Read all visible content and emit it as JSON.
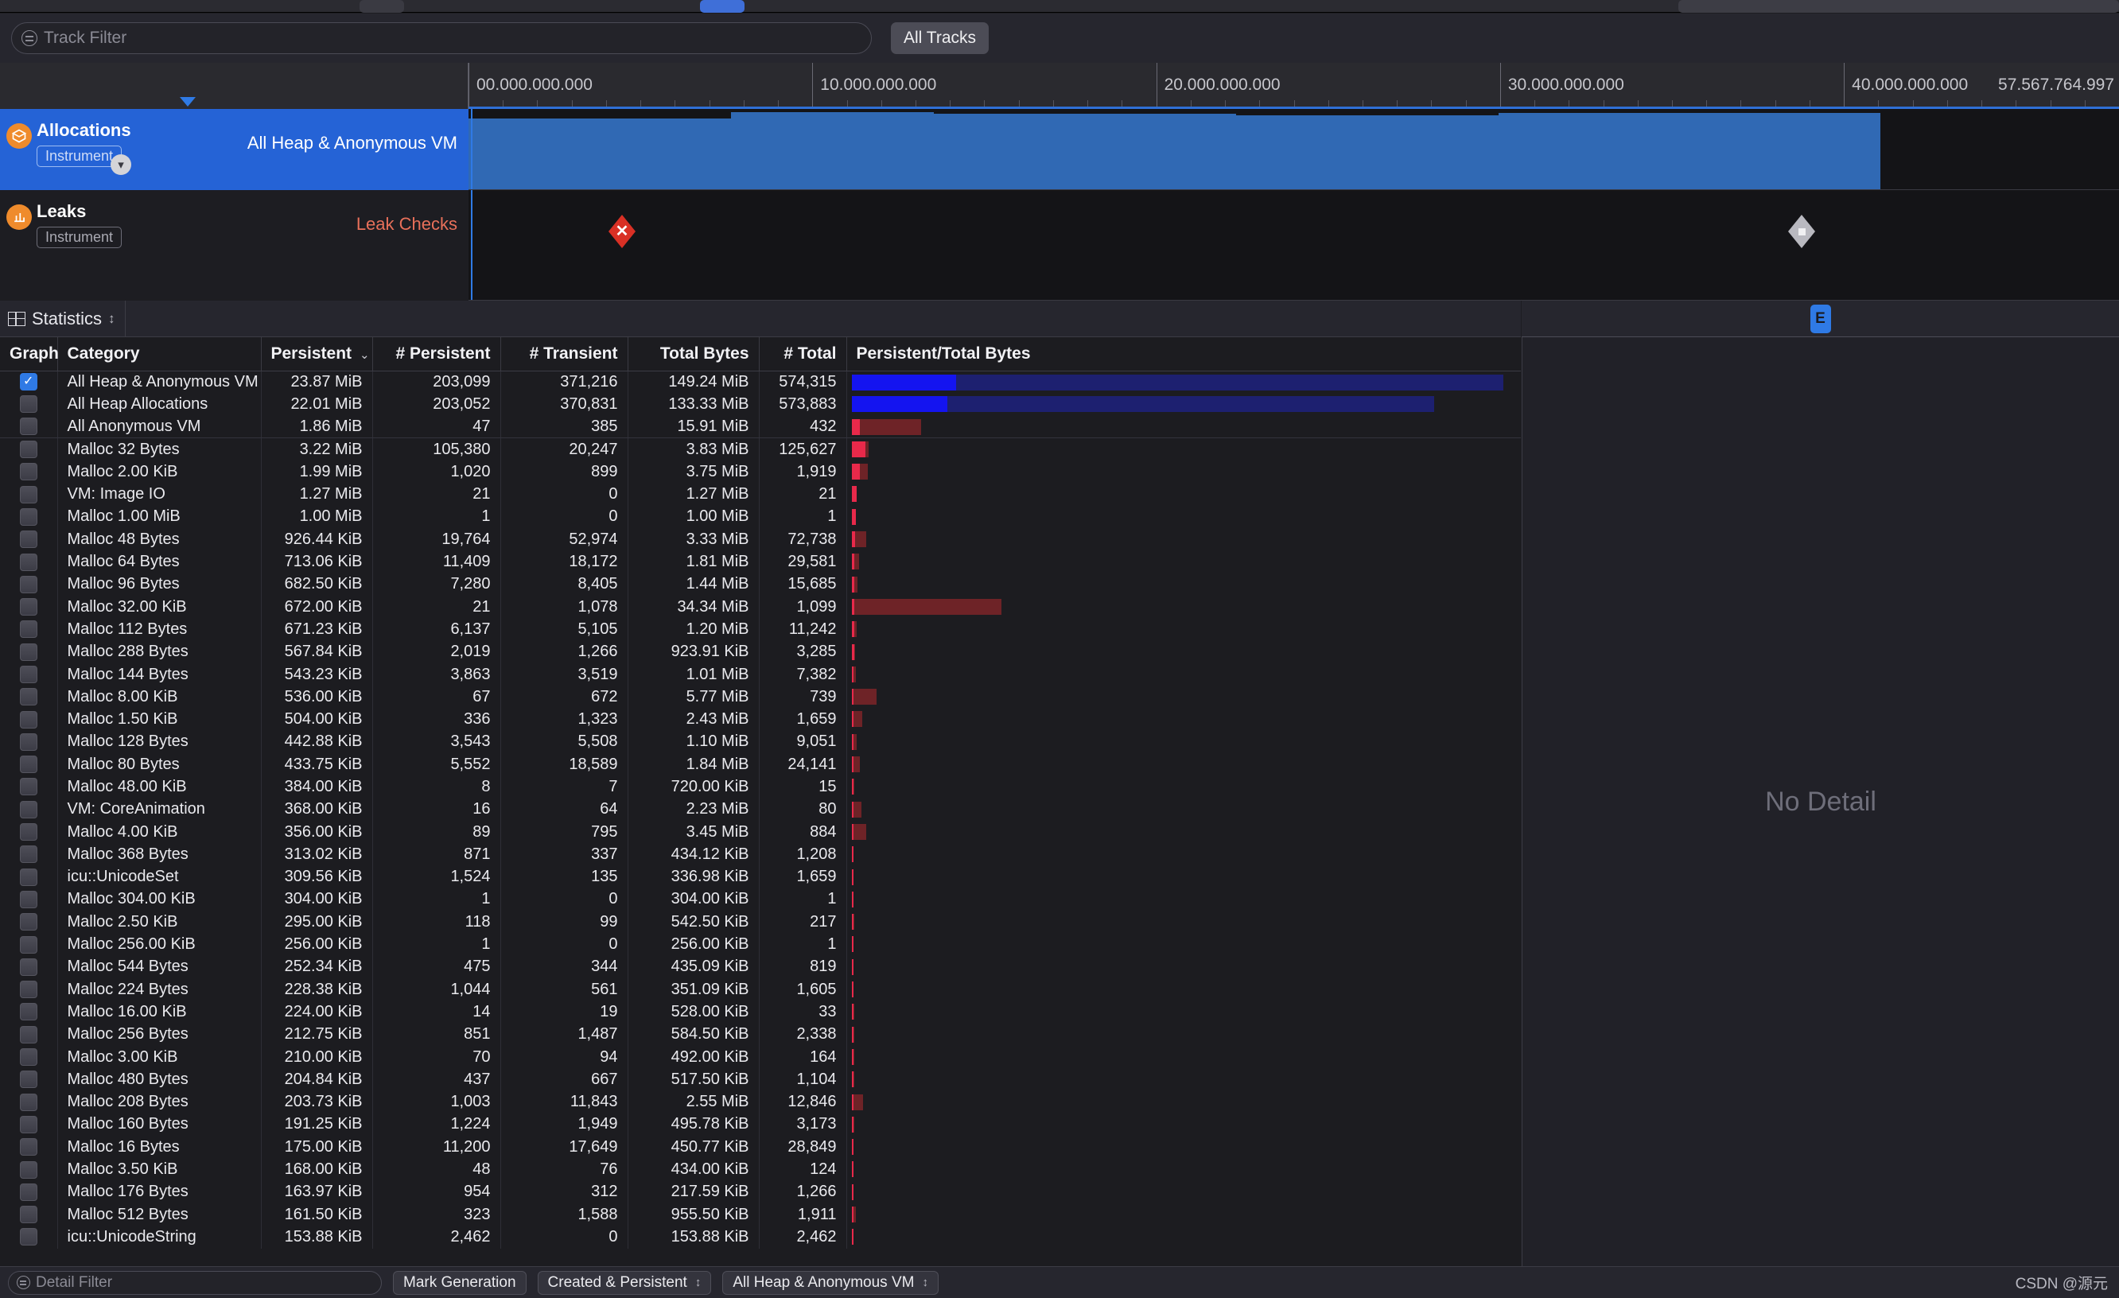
{
  "toolbar": {
    "track_filter_placeholder": "Track Filter",
    "all_tracks_label": "All Tracks"
  },
  "ruler": {
    "ticks": [
      "00.000.000.000",
      "10.000.000.000",
      "20.000.000.000",
      "30.000.000.000",
      "40.000.000.000"
    ],
    "end_label": "57.567.764.997"
  },
  "tracks": [
    {
      "name": "Allocations",
      "badge": "Instrument",
      "subtitle": "All Heap & Anonymous VM",
      "selected": true
    },
    {
      "name": "Leaks",
      "badge": "Instrument",
      "subtitle": "Leak Checks",
      "selected": false
    }
  ],
  "stats": {
    "label": "Statistics",
    "detail_badge": "E",
    "no_detail": "No Detail"
  },
  "table": {
    "columns": [
      "Graph",
      "Category",
      "Persistent",
      "# Persistent",
      "# Transient",
      "Total Bytes",
      "# Total",
      "Persistent/Total Bytes"
    ],
    "sorted_column": "Persistent",
    "rows": [
      {
        "checked": true,
        "category": "All Heap & Anonymous VM",
        "persistent": "23.87 MiB",
        "n_persistent": "203,099",
        "n_transient": "371,216",
        "total_bytes": "149.24 MiB",
        "n_total": "574,315",
        "bar_persist_pct": 16.0,
        "bar_total_pct": 100.0,
        "bar_color": "blue",
        "group_end": false
      },
      {
        "checked": false,
        "category": "All Heap Allocations",
        "persistent": "22.01 MiB",
        "n_persistent": "203,052",
        "n_transient": "370,831",
        "total_bytes": "133.33 MiB",
        "n_total": "573,883",
        "bar_persist_pct": 14.7,
        "bar_total_pct": 89.3,
        "bar_color": "blue",
        "group_end": false
      },
      {
        "checked": false,
        "category": "All Anonymous VM",
        "persistent": "1.86 MiB",
        "n_persistent": "47",
        "n_transient": "385",
        "total_bytes": "15.91 MiB",
        "n_total": "432",
        "bar_persist_pct": 1.25,
        "bar_total_pct": 10.7,
        "bar_color": "red",
        "group_end": true
      },
      {
        "checked": false,
        "category": "Malloc 32 Bytes",
        "persistent": "3.22 MiB",
        "n_persistent": "105,380",
        "n_transient": "20,247",
        "total_bytes": "3.83 MiB",
        "n_total": "125,627",
        "bar_persist_pct": 2.16,
        "bar_total_pct": 2.6,
        "bar_color": "red",
        "group_end": false
      },
      {
        "checked": false,
        "category": "Malloc 2.00 KiB",
        "persistent": "1.99 MiB",
        "n_persistent": "1,020",
        "n_transient": "899",
        "total_bytes": "3.75 MiB",
        "n_total": "1,919",
        "bar_persist_pct": 1.33,
        "bar_total_pct": 2.5,
        "bar_color": "red",
        "group_end": false
      },
      {
        "checked": false,
        "category": "VM: Image IO",
        "persistent": "1.27 MiB",
        "n_persistent": "21",
        "n_transient": "0",
        "total_bytes": "1.27 MiB",
        "n_total": "21",
        "bar_persist_pct": 0.85,
        "bar_total_pct": 0.85,
        "bar_color": "red",
        "group_end": false
      },
      {
        "checked": false,
        "category": "Malloc 1.00 MiB",
        "persistent": "1.00 MiB",
        "n_persistent": "1",
        "n_transient": "0",
        "total_bytes": "1.00 MiB",
        "n_total": "1",
        "bar_persist_pct": 0.67,
        "bar_total_pct": 0.67,
        "bar_color": "red",
        "group_end": false
      },
      {
        "checked": false,
        "category": "Malloc 48 Bytes",
        "persistent": "926.44 KiB",
        "n_persistent": "19,764",
        "n_transient": "52,974",
        "total_bytes": "3.33 MiB",
        "n_total": "72,738",
        "bar_persist_pct": 0.6,
        "bar_total_pct": 2.23,
        "bar_color": "red",
        "group_end": false
      },
      {
        "checked": false,
        "category": "Malloc 64 Bytes",
        "persistent": "713.06 KiB",
        "n_persistent": "11,409",
        "n_transient": "18,172",
        "total_bytes": "1.81 MiB",
        "n_total": "29,581",
        "bar_persist_pct": 0.47,
        "bar_total_pct": 1.21,
        "bar_color": "red",
        "group_end": false
      },
      {
        "checked": false,
        "category": "Malloc 96 Bytes",
        "persistent": "682.50 KiB",
        "n_persistent": "7,280",
        "n_transient": "8,405",
        "total_bytes": "1.44 MiB",
        "n_total": "15,685",
        "bar_persist_pct": 0.45,
        "bar_total_pct": 0.96,
        "bar_color": "red",
        "group_end": false
      },
      {
        "checked": false,
        "category": "Malloc 32.00 KiB",
        "persistent": "672.00 KiB",
        "n_persistent": "21",
        "n_transient": "1,078",
        "total_bytes": "34.34 MiB",
        "n_total": "1,099",
        "bar_persist_pct": 0.44,
        "bar_total_pct": 23.0,
        "bar_color": "red",
        "group_end": false
      },
      {
        "checked": false,
        "category": "Malloc 112 Bytes",
        "persistent": "671.23 KiB",
        "n_persistent": "6,137",
        "n_transient": "5,105",
        "total_bytes": "1.20 MiB",
        "n_total": "11,242",
        "bar_persist_pct": 0.44,
        "bar_total_pct": 0.8,
        "bar_color": "red",
        "group_end": false
      },
      {
        "checked": false,
        "category": "Malloc 288 Bytes",
        "persistent": "567.84 KiB",
        "n_persistent": "2,019",
        "n_transient": "1,266",
        "total_bytes": "923.91 KiB",
        "n_total": "3,285",
        "bar_persist_pct": 0.37,
        "bar_total_pct": 0.6,
        "bar_color": "red",
        "group_end": false
      },
      {
        "checked": false,
        "category": "Malloc 144 Bytes",
        "persistent": "543.23 KiB",
        "n_persistent": "3,863",
        "n_transient": "3,519",
        "total_bytes": "1.01 MiB",
        "n_total": "7,382",
        "bar_persist_pct": 0.36,
        "bar_total_pct": 0.68,
        "bar_color": "red",
        "group_end": false
      },
      {
        "checked": false,
        "category": "Malloc 8.00 KiB",
        "persistent": "536.00 KiB",
        "n_persistent": "67",
        "n_transient": "672",
        "total_bytes": "5.77 MiB",
        "n_total": "739",
        "bar_persist_pct": 0.35,
        "bar_total_pct": 3.87,
        "bar_color": "red",
        "group_end": false
      },
      {
        "checked": false,
        "category": "Malloc 1.50 KiB",
        "persistent": "504.00 KiB",
        "n_persistent": "336",
        "n_transient": "1,323",
        "total_bytes": "2.43 MiB",
        "n_total": "1,659",
        "bar_persist_pct": 0.33,
        "bar_total_pct": 1.63,
        "bar_color": "red",
        "group_end": false
      },
      {
        "checked": false,
        "category": "Malloc 128 Bytes",
        "persistent": "442.88 KiB",
        "n_persistent": "3,543",
        "n_transient": "5,508",
        "total_bytes": "1.10 MiB",
        "n_total": "9,051",
        "bar_persist_pct": 0.29,
        "bar_total_pct": 0.74,
        "bar_color": "red",
        "group_end": false
      },
      {
        "checked": false,
        "category": "Malloc 80 Bytes",
        "persistent": "433.75 KiB",
        "n_persistent": "5,552",
        "n_transient": "18,589",
        "total_bytes": "1.84 MiB",
        "n_total": "24,141",
        "bar_persist_pct": 0.28,
        "bar_total_pct": 1.23,
        "bar_color": "red",
        "group_end": false
      },
      {
        "checked": false,
        "category": "Malloc 48.00 KiB",
        "persistent": "384.00 KiB",
        "n_persistent": "8",
        "n_transient": "7",
        "total_bytes": "720.00 KiB",
        "n_total": "15",
        "bar_persist_pct": 0.25,
        "bar_total_pct": 0.47,
        "bar_color": "red",
        "group_end": false
      },
      {
        "checked": false,
        "category": "VM: CoreAnimation",
        "persistent": "368.00 KiB",
        "n_persistent": "16",
        "n_transient": "64",
        "total_bytes": "2.23 MiB",
        "n_total": "80",
        "bar_persist_pct": 0.24,
        "bar_total_pct": 1.49,
        "bar_color": "red",
        "group_end": false
      },
      {
        "checked": false,
        "category": "Malloc 4.00 KiB",
        "persistent": "356.00 KiB",
        "n_persistent": "89",
        "n_transient": "795",
        "total_bytes": "3.45 MiB",
        "n_total": "884",
        "bar_persist_pct": 0.23,
        "bar_total_pct": 2.31,
        "bar_color": "red",
        "group_end": false
      },
      {
        "checked": false,
        "category": "Malloc 368 Bytes",
        "persistent": "313.02 KiB",
        "n_persistent": "871",
        "n_transient": "337",
        "total_bytes": "434.12 KiB",
        "n_total": "1,208",
        "bar_persist_pct": 0.2,
        "bar_total_pct": 0.28,
        "bar_color": "red",
        "group_end": false
      },
      {
        "checked": false,
        "category": "icu::UnicodeSet",
        "persistent": "309.56 KiB",
        "n_persistent": "1,524",
        "n_transient": "135",
        "total_bytes": "336.98 KiB",
        "n_total": "1,659",
        "bar_persist_pct": 0.2,
        "bar_total_pct": 0.22,
        "bar_color": "red",
        "group_end": false
      },
      {
        "checked": false,
        "category": "Malloc 304.00 KiB",
        "persistent": "304.00 KiB",
        "n_persistent": "1",
        "n_transient": "0",
        "total_bytes": "304.00 KiB",
        "n_total": "1",
        "bar_persist_pct": 0.2,
        "bar_total_pct": 0.2,
        "bar_color": "red",
        "group_end": false
      },
      {
        "checked": false,
        "category": "Malloc 2.50 KiB",
        "persistent": "295.00 KiB",
        "n_persistent": "118",
        "n_transient": "99",
        "total_bytes": "542.50 KiB",
        "n_total": "217",
        "bar_persist_pct": 0.19,
        "bar_total_pct": 0.35,
        "bar_color": "red",
        "group_end": false
      },
      {
        "checked": false,
        "category": "Malloc 256.00 KiB",
        "persistent": "256.00 KiB",
        "n_persistent": "1",
        "n_transient": "0",
        "total_bytes": "256.00 KiB",
        "n_total": "1",
        "bar_persist_pct": 0.17,
        "bar_total_pct": 0.17,
        "bar_color": "red",
        "group_end": false
      },
      {
        "checked": false,
        "category": "Malloc 544 Bytes",
        "persistent": "252.34 KiB",
        "n_persistent": "475",
        "n_transient": "344",
        "total_bytes": "435.09 KiB",
        "n_total": "819",
        "bar_persist_pct": 0.16,
        "bar_total_pct": 0.28,
        "bar_color": "red",
        "group_end": false
      },
      {
        "checked": false,
        "category": "Malloc 224 Bytes",
        "persistent": "228.38 KiB",
        "n_persistent": "1,044",
        "n_transient": "561",
        "total_bytes": "351.09 KiB",
        "n_total": "1,605",
        "bar_persist_pct": 0.15,
        "bar_total_pct": 0.23,
        "bar_color": "red",
        "group_end": false
      },
      {
        "checked": false,
        "category": "Malloc 16.00 KiB",
        "persistent": "224.00 KiB",
        "n_persistent": "14",
        "n_transient": "19",
        "total_bytes": "528.00 KiB",
        "n_total": "33",
        "bar_persist_pct": 0.15,
        "bar_total_pct": 0.34,
        "bar_color": "red",
        "group_end": false
      },
      {
        "checked": false,
        "category": "Malloc 256 Bytes",
        "persistent": "212.75 KiB",
        "n_persistent": "851",
        "n_transient": "1,487",
        "total_bytes": "584.50 KiB",
        "n_total": "2,338",
        "bar_persist_pct": 0.14,
        "bar_total_pct": 0.38,
        "bar_color": "red",
        "group_end": false
      },
      {
        "checked": false,
        "category": "Malloc 3.00 KiB",
        "persistent": "210.00 KiB",
        "n_persistent": "70",
        "n_transient": "94",
        "total_bytes": "492.00 KiB",
        "n_total": "164",
        "bar_persist_pct": 0.14,
        "bar_total_pct": 0.32,
        "bar_color": "red",
        "group_end": false
      },
      {
        "checked": false,
        "category": "Malloc 480 Bytes",
        "persistent": "204.84 KiB",
        "n_persistent": "437",
        "n_transient": "667",
        "total_bytes": "517.50 KiB",
        "n_total": "1,104",
        "bar_persist_pct": 0.13,
        "bar_total_pct": 0.33,
        "bar_color": "red",
        "group_end": false
      },
      {
        "checked": false,
        "category": "Malloc 208 Bytes",
        "persistent": "203.73 KiB",
        "n_persistent": "1,003",
        "n_transient": "11,843",
        "total_bytes": "2.55 MiB",
        "n_total": "12,846",
        "bar_persist_pct": 0.13,
        "bar_total_pct": 1.71,
        "bar_color": "red",
        "group_end": false
      },
      {
        "checked": false,
        "category": "Malloc 160 Bytes",
        "persistent": "191.25 KiB",
        "n_persistent": "1,224",
        "n_transient": "1,949",
        "total_bytes": "495.78 KiB",
        "n_total": "3,173",
        "bar_persist_pct": 0.12,
        "bar_total_pct": 0.32,
        "bar_color": "red",
        "group_end": false
      },
      {
        "checked": false,
        "category": "Malloc 16 Bytes",
        "persistent": "175.00 KiB",
        "n_persistent": "11,200",
        "n_transient": "17,649",
        "total_bytes": "450.77 KiB",
        "n_total": "28,849",
        "bar_persist_pct": 0.11,
        "bar_total_pct": 0.29,
        "bar_color": "red",
        "group_end": false
      },
      {
        "checked": false,
        "category": "Malloc 3.50 KiB",
        "persistent": "168.00 KiB",
        "n_persistent": "48",
        "n_transient": "76",
        "total_bytes": "434.00 KiB",
        "n_total": "124",
        "bar_persist_pct": 0.11,
        "bar_total_pct": 0.28,
        "bar_color": "red",
        "group_end": false
      },
      {
        "checked": false,
        "category": "Malloc 176 Bytes",
        "persistent": "163.97 KiB",
        "n_persistent": "954",
        "n_transient": "312",
        "total_bytes": "217.59 KiB",
        "n_total": "1,266",
        "bar_persist_pct": 0.11,
        "bar_total_pct": 0.14,
        "bar_color": "red",
        "group_end": false
      },
      {
        "checked": false,
        "category": "Malloc 512 Bytes",
        "persistent": "161.50 KiB",
        "n_persistent": "323",
        "n_transient": "1,588",
        "total_bytes": "955.50 KiB",
        "n_total": "1,911",
        "bar_persist_pct": 0.1,
        "bar_total_pct": 0.62,
        "bar_color": "red",
        "group_end": false
      },
      {
        "checked": false,
        "category": "icu::UnicodeString",
        "persistent": "153.88 KiB",
        "n_persistent": "2,462",
        "n_transient": "0",
        "total_bytes": "153.88 KiB",
        "n_total": "2,462",
        "bar_persist_pct": 0.1,
        "bar_total_pct": 0.1,
        "bar_color": "red",
        "group_end": false
      }
    ]
  },
  "bottom": {
    "detail_filter_placeholder": "Detail Filter",
    "mark_generation_label": "Mark Generation",
    "created_persistent_label": "Created & Persistent",
    "scope_label": "All Heap & Anonymous VM",
    "watermark": "CSDN @源元"
  }
}
